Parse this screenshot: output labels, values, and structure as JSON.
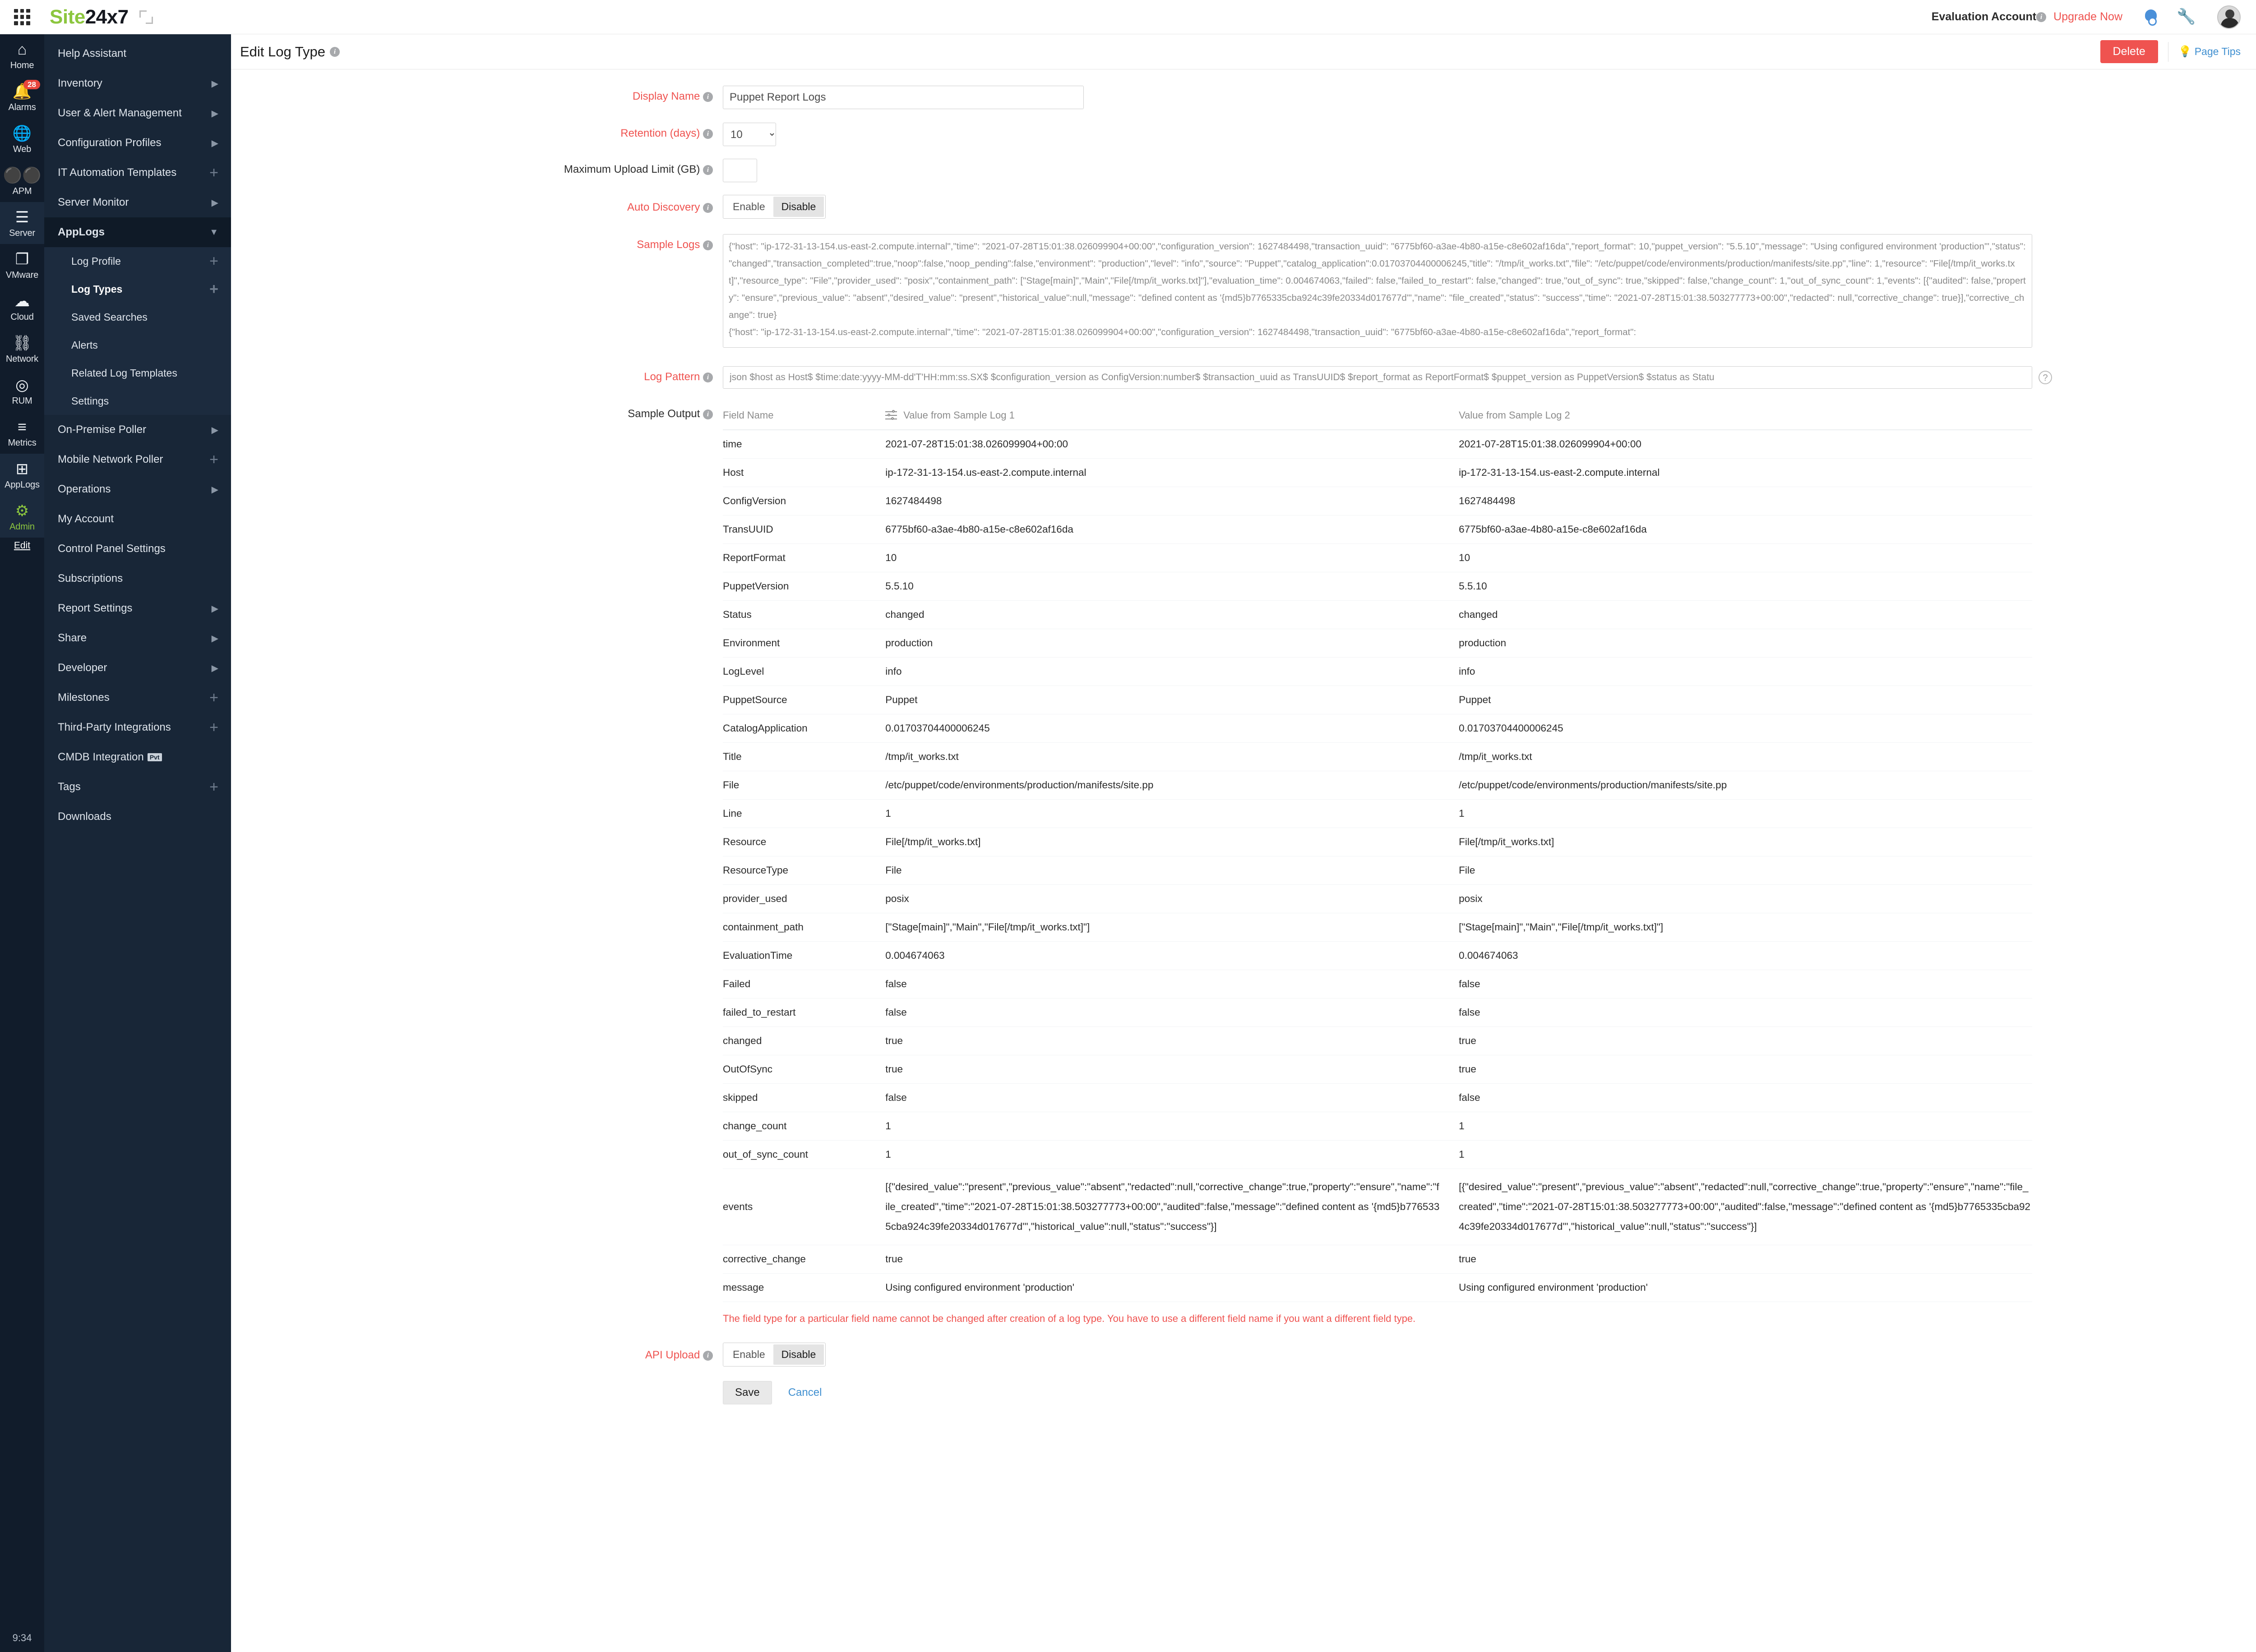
{
  "topbar": {
    "brand_green": "Site",
    "brand_dark": "24x7",
    "account_label": "Evaluation Account",
    "upgrade_label": "Upgrade Now",
    "icons": [
      "waffle-icon",
      "expand-icon",
      "bell-icon",
      "wrench-icon",
      "avatar"
    ]
  },
  "rail": {
    "clock": "9:34",
    "edit_label": "Edit",
    "items": [
      {
        "label": "Home",
        "icon": "home-icon",
        "badge": ""
      },
      {
        "label": "Alarms",
        "icon": "bell-icon",
        "badge": "28"
      },
      {
        "label": "Web",
        "icon": "globe-icon",
        "badge": ""
      },
      {
        "label": "APM",
        "icon": "binoculars-icon",
        "badge": ""
      },
      {
        "label": "Server",
        "icon": "server-icon",
        "badge": ""
      },
      {
        "label": "VMware",
        "icon": "windows-icon",
        "badge": ""
      },
      {
        "label": "Cloud",
        "icon": "cloud-icon",
        "badge": ""
      },
      {
        "label": "Network",
        "icon": "network-icon",
        "badge": ""
      },
      {
        "label": "RUM",
        "icon": "rum-icon",
        "badge": ""
      },
      {
        "label": "Metrics",
        "icon": "layers-icon",
        "badge": ""
      },
      {
        "label": "AppLogs",
        "icon": "applogs-icon",
        "badge": ""
      },
      {
        "label": "Admin",
        "icon": "gear-icon",
        "badge": ""
      }
    ]
  },
  "nav": {
    "items": [
      {
        "label": "Help Assistant",
        "affordance": "none"
      },
      {
        "label": "Inventory",
        "affordance": "arrow"
      },
      {
        "label": "User & Alert Management",
        "affordance": "arrow"
      },
      {
        "label": "Configuration Profiles",
        "affordance": "arrow"
      },
      {
        "label": "IT Automation Templates",
        "affordance": "plus"
      },
      {
        "label": "Server Monitor",
        "affordance": "arrow"
      },
      {
        "label": "AppLogs",
        "affordance": "down",
        "selected": true
      }
    ],
    "sub_items": [
      {
        "label": "Log Profile",
        "affordance": "plus"
      },
      {
        "label": "Log Types",
        "affordance": "plus",
        "selected": true
      },
      {
        "label": "Saved Searches",
        "affordance": "none"
      },
      {
        "label": "Alerts",
        "affordance": "none"
      },
      {
        "label": "Related Log Templates",
        "affordance": "none"
      },
      {
        "label": "Settings",
        "affordance": "none"
      }
    ],
    "items_after": [
      {
        "label": "On-Premise Poller",
        "affordance": "arrow"
      },
      {
        "label": "Mobile Network Poller",
        "affordance": "plus"
      },
      {
        "label": "Operations",
        "affordance": "arrow"
      },
      {
        "label": "My Account",
        "affordance": "none"
      },
      {
        "label": "Control Panel Settings",
        "affordance": "none"
      },
      {
        "label": "Subscriptions",
        "affordance": "none"
      },
      {
        "label": "Report Settings",
        "affordance": "arrow"
      },
      {
        "label": "Share",
        "affordance": "arrow"
      },
      {
        "label": "Developer",
        "affordance": "arrow"
      },
      {
        "label": "Milestones",
        "affordance": "plus"
      },
      {
        "label": "Third-Party Integrations",
        "affordance": "plus"
      },
      {
        "label": "CMDB Integration",
        "affordance": "none",
        "tag": "Pvt"
      },
      {
        "label": "Tags",
        "affordance": "plus"
      },
      {
        "label": "Downloads",
        "affordance": "none"
      }
    ]
  },
  "page": {
    "title": "Edit Log Type",
    "delete_label": "Delete",
    "page_tips_label": "Page Tips"
  },
  "form": {
    "display_name_label": "Display Name",
    "display_name_value": "Puppet Report Logs",
    "retention_label": "Retention (days)",
    "retention_value": "10",
    "retention_options": [
      "10"
    ],
    "max_upload_label": "Maximum Upload Limit (GB)",
    "max_upload_value": "",
    "auto_discovery_label": "Auto Discovery",
    "auto_discovery_enable": "Enable",
    "auto_discovery_disable": "Disable",
    "auto_discovery_selected": "Disable",
    "sample_logs_label": "Sample Logs",
    "sample_logs_value": "{\"host\": \"ip-172-31-13-154.us-east-2.compute.internal\",\"time\": \"2021-07-28T15:01:38.026099904+00:00\",\"configuration_version\": 1627484498,\"transaction_uuid\": \"6775bf60-a3ae-4b80-a15e-c8e602af16da\",\"report_format\": 10,\"puppet_version\": \"5.5.10\",\"message\": \"Using configured environment 'production'\",\"status\": \"changed\",\"transaction_completed\":true,\"noop\":false,\"noop_pending\":false,\"environment\": \"production\",\"level\": \"info\",\"source\": \"Puppet\",\"catalog_application\":0.01703704400006245,\"title\": \"/tmp/it_works.txt\",\"file\": \"/etc/puppet/code/environments/production/manifests/site.pp\",\"line\": 1,\"resource\": \"File[/tmp/it_works.txt]\",\"resource_type\": \"File\",\"provider_used\": \"posix\",\"containment_path\": [\"Stage[main]\",\"Main\",\"File[/tmp/it_works.txt]\"],\"evaluation_time\": 0.004674063,\"failed\": false,\"failed_to_restart\": false,\"changed\": true,\"out_of_sync\": true,\"skipped\": false,\"change_count\": 1,\"out_of_sync_count\": 1,\"events\": [{\"audited\": false,\"property\": \"ensure\",\"previous_value\": \"absent\",\"desired_value\": \"present\",\"historical_value\":null,\"message\": \"defined content as '{md5}b7765335cba924c39fe20334d017677d'\",\"name\": \"file_created\",\"status\": \"success\",\"time\": \"2021-07-28T15:01:38.503277773+00:00\",\"redacted\": null,\"corrective_change\": true}],\"corrective_change\": true}\n{\"host\": \"ip-172-31-13-154.us-east-2.compute.internal\",\"time\": \"2021-07-28T15:01:38.026099904+00:00\",\"configuration_version\": 1627484498,\"transaction_uuid\": \"6775bf60-a3ae-4b80-a15e-c8e602af16da\",\"report_format\":",
    "log_pattern_label": "Log Pattern",
    "log_pattern_value": "json $host as Host$ $time:date:yyyy-MM-dd'T'HH:mm:ss.SX$ $configuration_version as ConfigVersion:number$ $transaction_uuid as TransUUID$ $report_format as ReportFormat$ $puppet_version as PuppetVersion$ $status as Statu",
    "sample_output_label": "Sample Output",
    "api_upload_label": "API Upload",
    "api_upload_enable": "Enable",
    "api_upload_disable": "Disable",
    "api_upload_selected": "Disable",
    "warning": "The field type for a particular field name cannot be changed after creation of a log type. You have to use a different field name if you want a different field type.",
    "save_label": "Save",
    "cancel_label": "Cancel"
  },
  "sample_output": {
    "columns": [
      "Field Name",
      "Value from Sample Log 1",
      "Value from Sample Log 2"
    ],
    "rows": [
      {
        "field": "time",
        "v1": "2021-07-28T15:01:38.026099904+00:00",
        "v2": "2021-07-28T15:01:38.026099904+00:00"
      },
      {
        "field": "Host",
        "v1": "ip-172-31-13-154.us-east-2.compute.internal",
        "v2": "ip-172-31-13-154.us-east-2.compute.internal"
      },
      {
        "field": "ConfigVersion",
        "v1": "1627484498",
        "v2": "1627484498"
      },
      {
        "field": "TransUUID",
        "v1": "6775bf60-a3ae-4b80-a15e-c8e602af16da",
        "v2": "6775bf60-a3ae-4b80-a15e-c8e602af16da"
      },
      {
        "field": "ReportFormat",
        "v1": "10",
        "v2": "10"
      },
      {
        "field": "PuppetVersion",
        "v1": "5.5.10",
        "v2": "5.5.10"
      },
      {
        "field": "Status",
        "v1": "changed",
        "v2": "changed"
      },
      {
        "field": "Environment",
        "v1": "production",
        "v2": "production"
      },
      {
        "field": "LogLevel",
        "v1": "info",
        "v2": "info"
      },
      {
        "field": "PuppetSource",
        "v1": "Puppet",
        "v2": "Puppet"
      },
      {
        "field": "CatalogApplication",
        "v1": "0.01703704400006245",
        "v2": "0.01703704400006245"
      },
      {
        "field": "Title",
        "v1": "/tmp/it_works.txt",
        "v2": "/tmp/it_works.txt"
      },
      {
        "field": "File",
        "v1": "/etc/puppet/code/environments/production/manifests/site.pp",
        "v2": "/etc/puppet/code/environments/production/manifests/site.pp"
      },
      {
        "field": "Line",
        "v1": "1",
        "v2": "1"
      },
      {
        "field": "Resource",
        "v1": "File[/tmp/it_works.txt]",
        "v2": "File[/tmp/it_works.txt]"
      },
      {
        "field": "ResourceType",
        "v1": "File",
        "v2": "File"
      },
      {
        "field": "provider_used",
        "v1": "posix",
        "v2": "posix"
      },
      {
        "field": "containment_path",
        "v1": "[\"Stage[main]\",\"Main\",\"File[/tmp/it_works.txt]\"]",
        "v2": "[\"Stage[main]\",\"Main\",\"File[/tmp/it_works.txt]\"]"
      },
      {
        "field": "EvaluationTime",
        "v1": "0.004674063",
        "v2": "0.004674063"
      },
      {
        "field": "Failed",
        "v1": "false",
        "v2": "false"
      },
      {
        "field": "failed_to_restart",
        "v1": "false",
        "v2": "false"
      },
      {
        "field": "changed",
        "v1": "true",
        "v2": "true"
      },
      {
        "field": "OutOfSync",
        "v1": "true",
        "v2": "true"
      },
      {
        "field": "skipped",
        "v1": "false",
        "v2": "false"
      },
      {
        "field": "change_count",
        "v1": "1",
        "v2": "1"
      },
      {
        "field": "out_of_sync_count",
        "v1": "1",
        "v2": "1"
      },
      {
        "field": "events",
        "v1": "[{\"desired_value\":\"present\",\"previous_value\":\"absent\",\"redacted\":null,\"corrective_change\":true,\"property\":\"ensure\",\"name\":\"file_created\",\"time\":\"2021-07-28T15:01:38.503277773+00:00\",\"audited\":false,\"message\":\"defined content as '{md5}b7765335cba924c39fe20334d017677d'\",\"historical_value\":null,\"status\":\"success\"}]",
        "v2": "[{\"desired_value\":\"present\",\"previous_value\":\"absent\",\"redacted\":null,\"corrective_change\":true,\"property\":\"ensure\",\"name\":\"file_created\",\"time\":\"2021-07-28T15:01:38.503277773+00:00\",\"audited\":false,\"message\":\"defined content as '{md5}b7765335cba924c39fe20334d017677d'\",\"historical_value\":null,\"status\":\"success\"}]"
      },
      {
        "field": "corrective_change",
        "v1": "true",
        "v2": "true"
      },
      {
        "field": "message",
        "v1": "Using configured environment 'production'",
        "v2": "Using configured environment 'production'"
      }
    ]
  },
  "colors": {
    "brand_green": "#8cc63f",
    "accent_red": "#ef5350",
    "nav_bg": "#182637",
    "rail_bg": "#111c2b",
    "link_blue": "#3f8fd0"
  }
}
